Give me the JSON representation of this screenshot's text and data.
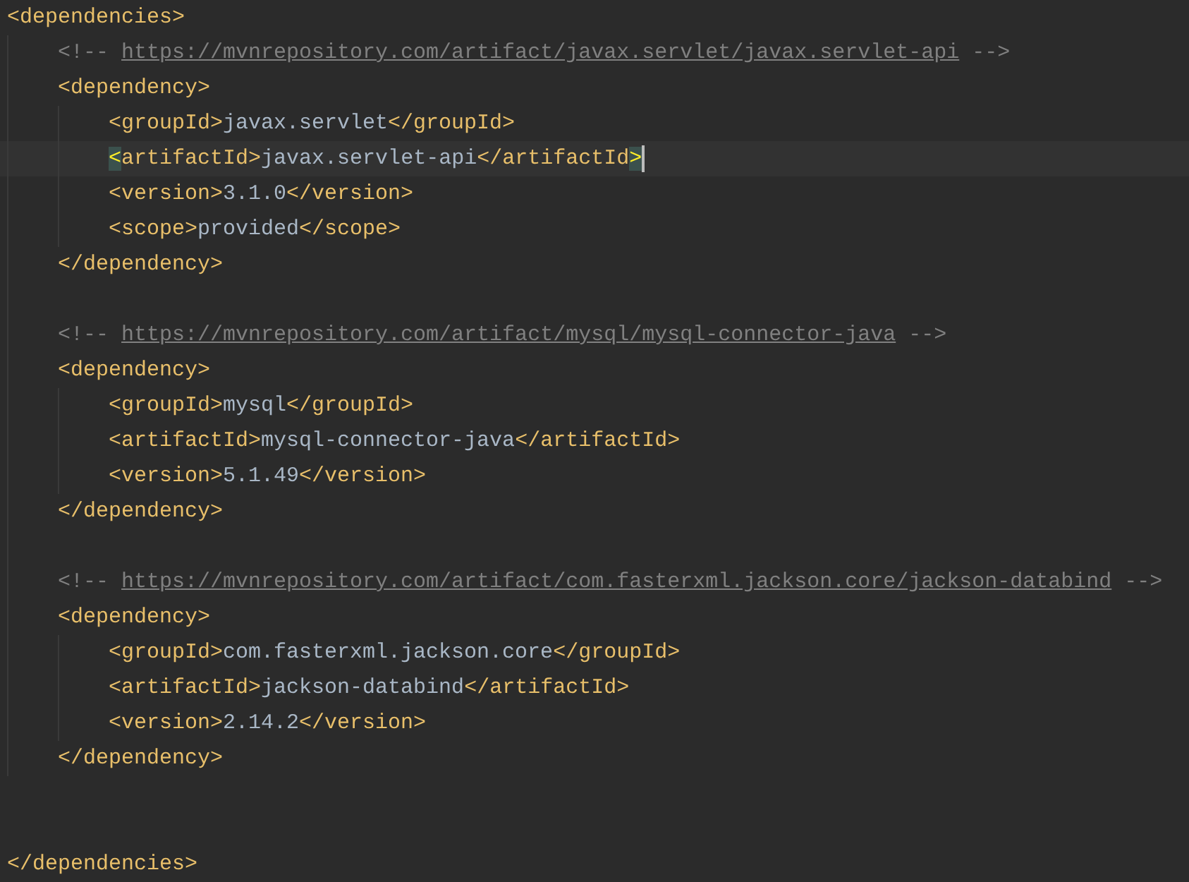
{
  "editor": {
    "lines": [
      {
        "current": false,
        "segments": [
          {
            "kind": "tag",
            "text": "<dependencies>"
          }
        ],
        "children": [
          {
            "current": false,
            "segments": [
              {
                "kind": "comment",
                "text": "<!-- "
              },
              {
                "kind": "link",
                "text": "https://mvnrepository.com/artifact/javax.servlet/javax.servlet-api"
              },
              {
                "kind": "comment",
                "text": " -->"
              }
            ]
          },
          {
            "current": false,
            "segments": [
              {
                "kind": "tag",
                "text": "<dependency>"
              }
            ],
            "children": [
              {
                "current": false,
                "segments": [
                  {
                    "kind": "tag",
                    "text": "<groupId>"
                  },
                  {
                    "kind": "text",
                    "text": "javax.servlet"
                  },
                  {
                    "kind": "tag",
                    "text": "</groupId>"
                  }
                ]
              },
              {
                "current": true,
                "segments": [
                  {
                    "kind": "match",
                    "text": "<"
                  },
                  {
                    "kind": "tag",
                    "text": "artifactId>"
                  },
                  {
                    "kind": "text",
                    "text": "javax.servlet-api"
                  },
                  {
                    "kind": "tag",
                    "text": "</artifactId"
                  },
                  {
                    "kind": "match",
                    "text": ">"
                  }
                ]
              },
              {
                "current": false,
                "segments": [
                  {
                    "kind": "tag",
                    "text": "<version>"
                  },
                  {
                    "kind": "text",
                    "text": "3.1.0"
                  },
                  {
                    "kind": "tag",
                    "text": "</version>"
                  }
                ]
              },
              {
                "current": false,
                "segments": [
                  {
                    "kind": "tag",
                    "text": "<scope>"
                  },
                  {
                    "kind": "text",
                    "text": "provided"
                  },
                  {
                    "kind": "tag",
                    "text": "</scope>"
                  }
                ]
              }
            ]
          },
          {
            "current": false,
            "segments": [
              {
                "kind": "tag",
                "text": "</dependency>"
              }
            ]
          },
          {
            "current": false
          },
          {
            "current": false,
            "segments": [
              {
                "kind": "comment",
                "text": "<!-- "
              },
              {
                "kind": "link",
                "text": "https://mvnrepository.com/artifact/mysql/mysql-connector-java"
              },
              {
                "kind": "comment",
                "text": " -->"
              }
            ]
          },
          {
            "current": false,
            "segments": [
              {
                "kind": "tag",
                "text": "<dependency>"
              }
            ],
            "children": [
              {
                "current": false,
                "segments": [
                  {
                    "kind": "tag",
                    "text": "<groupId>"
                  },
                  {
                    "kind": "text",
                    "text": "mysql"
                  },
                  {
                    "kind": "tag",
                    "text": "</groupId>"
                  }
                ]
              },
              {
                "current": false,
                "segments": [
                  {
                    "kind": "tag",
                    "text": "<artifactId>"
                  },
                  {
                    "kind": "text",
                    "text": "mysql-connector-java"
                  },
                  {
                    "kind": "tag",
                    "text": "</artifactId>"
                  }
                ]
              },
              {
                "current": false,
                "segments": [
                  {
                    "kind": "tag",
                    "text": "<version>"
                  },
                  {
                    "kind": "text",
                    "text": "5.1.49"
                  },
                  {
                    "kind": "tag",
                    "text": "</version>"
                  }
                ]
              }
            ]
          },
          {
            "current": false,
            "segments": [
              {
                "kind": "tag",
                "text": "</dependency>"
              }
            ]
          },
          {
            "current": false
          },
          {
            "current": false,
            "segments": [
              {
                "kind": "comment",
                "text": "<!-- "
              },
              {
                "kind": "link",
                "text": "https://mvnrepository.com/artifact/com.fasterxml.jackson.core/jackson-databind"
              },
              {
                "kind": "comment",
                "text": " -->"
              }
            ]
          },
          {
            "current": false,
            "segments": [
              {
                "kind": "tag",
                "text": "<dependency>"
              }
            ],
            "children": [
              {
                "current": false,
                "segments": [
                  {
                    "kind": "tag",
                    "text": "<groupId>"
                  },
                  {
                    "kind": "text",
                    "text": "com.fasterxml.jackson.core"
                  },
                  {
                    "kind": "tag",
                    "text": "</groupId>"
                  }
                ]
              },
              {
                "current": false,
                "segments": [
                  {
                    "kind": "tag",
                    "text": "<artifactId>"
                  },
                  {
                    "kind": "text",
                    "text": "jackson-databind"
                  },
                  {
                    "kind": "tag",
                    "text": "</artifactId>"
                  }
                ]
              },
              {
                "current": false,
                "segments": [
                  {
                    "kind": "tag",
                    "text": "<version>"
                  },
                  {
                    "kind": "text",
                    "text": "2.14.2"
                  },
                  {
                    "kind": "tag",
                    "text": "</version>"
                  }
                ]
              }
            ]
          },
          {
            "current": false,
            "segments": [
              {
                "kind": "tag",
                "text": "</dependency>"
              }
            ]
          }
        ]
      },
      {
        "current": false
      },
      {
        "current": false
      },
      {
        "current": false,
        "segments": [
          {
            "kind": "tag",
            "text": "</dependencies>"
          }
        ]
      }
    ]
  }
}
